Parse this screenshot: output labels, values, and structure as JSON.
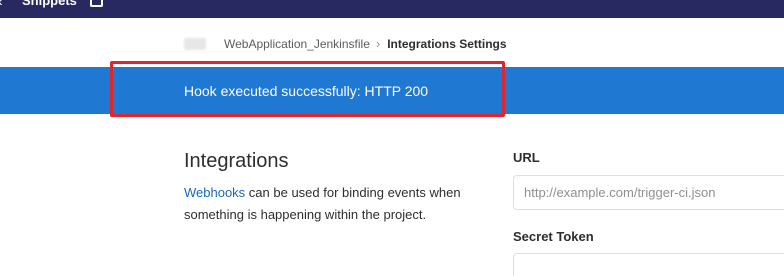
{
  "topbar": {
    "back_icon": "chevron-left-icon",
    "snippets_label": "Snippets",
    "todo_icon": "todo-list-icon",
    "background": "#292961"
  },
  "breadcrumb": {
    "project": "WebApplication_Jenkinsfile",
    "separator": "›",
    "current": "Integrations Settings"
  },
  "flash": {
    "message": "Hook executed successfully: HTTP 200",
    "background": "#1f78d1",
    "highlight_color": "#e0262c"
  },
  "integrations": {
    "title": "Integrations",
    "link_text": "Webhooks",
    "description": " can be used for binding events when something is happening within the project."
  },
  "form": {
    "url_label": "URL",
    "url_placeholder": "http://example.com/trigger-ci.json",
    "url_value": "",
    "secret_token_label": "Secret Token",
    "secret_token_value": ""
  }
}
